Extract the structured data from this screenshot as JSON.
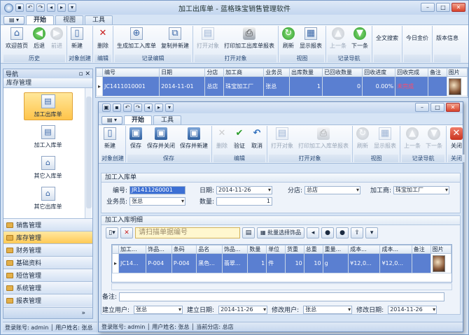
{
  "app": {
    "title": "加工出库单 - 蓝格珠宝销售管理软件"
  },
  "main_tabs": [
    "开始",
    "视图",
    "工具"
  ],
  "menu_btn": "▾",
  "ribbon_groups": [
    {
      "name": "历史",
      "buttons": [
        "欢迎首页",
        "后退",
        "前进"
      ]
    },
    {
      "name": "对象创建",
      "buttons": [
        "新建"
      ]
    },
    {
      "name": "编辑",
      "buttons": [
        "删除"
      ]
    },
    {
      "name": "记录编辑",
      "buttons": [
        "生成加工入库单",
        "复制并新建"
      ]
    },
    {
      "name": "打开对象",
      "buttons": [
        "打开对象",
        "打印加工出库单报表"
      ]
    },
    {
      "name": "视图",
      "buttons": [
        "刷新",
        "显示报表"
      ]
    },
    {
      "name": "记录导航",
      "buttons": [
        "上一条",
        "下一条"
      ]
    },
    {
      "name": "",
      "buttons": [
        "全文搜索"
      ]
    },
    {
      "name": "",
      "buttons": [
        "今日金价"
      ]
    },
    {
      "name": "",
      "buttons": [
        "版本信息"
      ]
    }
  ],
  "sidebar": {
    "header": "导航",
    "section": "库存管理",
    "items": [
      "加工出库单",
      "加工入库单",
      "其它入库单",
      "其它出库单"
    ],
    "nav": [
      "销售管理",
      "库存管理",
      "财务管理",
      "基础资料",
      "短信管理",
      "系统管理",
      "报表管理"
    ],
    "bottom": "»"
  },
  "main_grid": {
    "columns": [
      "编号",
      "日期",
      "分店",
      "加工商",
      "业务员",
      "出库数量",
      "已回收数量",
      "回收进度",
      "回收完成",
      "备注",
      "图片"
    ],
    "rows": [
      [
        "JC1411010001",
        "2014-11-01",
        "总店",
        "珠宝加工厂",
        "张总",
        "1",
        "0",
        "0.00%",
        "未完成",
        "",
        ""
      ]
    ]
  },
  "status": {
    "main": "登录账号: admin  │ 用户姓名: 张总"
  },
  "child": {
    "tabs": [
      "开始",
      "工具"
    ],
    "ribbon_groups": [
      {
        "name": "对象创建",
        "buttons": [
          "新建"
        ]
      },
      {
        "name": "保存",
        "buttons": [
          "保存",
          "保存并关闭",
          "保存并新建"
        ]
      },
      {
        "name": "编辑",
        "buttons": [
          "删除",
          "验证",
          "取消"
        ]
      },
      {
        "name": "打开对象",
        "buttons": [
          "打开对象",
          "打印加工入库单报表"
        ]
      },
      {
        "name": "视图",
        "buttons": [
          "刷新",
          "显示报表"
        ]
      },
      {
        "name": "记录导航",
        "buttons": [
          "上一条",
          "下一条"
        ]
      },
      {
        "name": "关闭",
        "buttons": [
          "关闭"
        ]
      }
    ],
    "form": {
      "title": "加工入库单",
      "no_label": "编号:",
      "no_value": "JR1411260001",
      "date_label": "日期:",
      "date_value": "2014-11-26",
      "branch_label": "分店:",
      "branch_value": "总店",
      "processor_label": "加工商:",
      "processor_value": "珠宝加工厂",
      "salesman_label": "业务员:",
      "salesman_value": "张总",
      "qty_label": "数量:",
      "qty_value": "1"
    },
    "detail": {
      "title": "加工入库明细",
      "scan_placeholder": "请扫描单据编号",
      "batch_label": "批量选择饰品",
      "columns": [
        "加工...",
        "饰品...",
        "条码",
        "品名",
        "饰品...",
        "数量",
        "单位",
        "货重",
        "总重",
        "重量...",
        "成本...",
        "成本...",
        "备注",
        "图片"
      ],
      "rows": [
        [
          "JC14...",
          "P-004",
          "P-004",
          "黑色...",
          "翡翠...",
          "1",
          "件",
          "10",
          "10",
          "g",
          "¥12,0...",
          "¥12,0...",
          "",
          ""
        ]
      ]
    },
    "memo_label": "备注:",
    "audit": {
      "created_by_label": "建立用户:",
      "created_by": "张总",
      "created_date_label": "建立日期:",
      "created_date": "2014-11-26",
      "modified_by_label": "修改用户:",
      "modified_by": "张总",
      "modified_date_label": "修改日期:",
      "modified_date": "2014-11-26"
    },
    "status": "登录账号: admin  │ 用户姓名: 张总  │ 当前分店: 总店"
  }
}
